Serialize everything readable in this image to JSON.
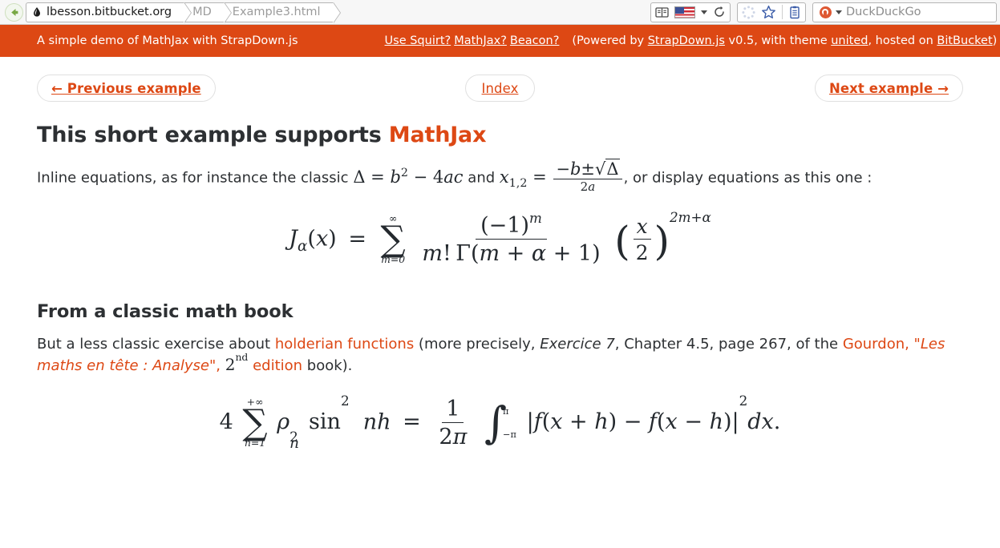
{
  "browser": {
    "back_icon": "back-arrow-icon",
    "breadcrumbs": [
      {
        "label": "lbesson.bitbucket.org",
        "kind": "host",
        "icon": "droplet-icon"
      },
      {
        "label": "MD",
        "kind": "dim"
      },
      {
        "label": "Example3.html",
        "kind": "dim"
      }
    ],
    "toolbar_icons": [
      "reader-mode-icon",
      "us-flag-icon",
      "language-caret-icon",
      "reload-icon",
      "loading-spinner-icon",
      "bookmark-star-icon",
      "clipboard-icon"
    ],
    "search": {
      "engine": "DuckDuckGo",
      "engine_icon": "duckduckgo-icon",
      "placeholder": "DuckDuckGo",
      "value": ""
    }
  },
  "navbar": {
    "brand": "A simple demo of MathJax with StrapDown.js",
    "links": [
      {
        "label": "Use Squirt?"
      },
      {
        "label": "MathJax?"
      },
      {
        "label": "Beacon?"
      }
    ],
    "powered_prefix": "(Powered by",
    "powered_link": "StrapDown.js",
    "version_text": "v0.5, with theme",
    "theme_link": "united",
    "hosted_text": ", hosted on",
    "host_link": "BitBucket",
    "close_paren": ")",
    "background": "#dd4814"
  },
  "nav_buttons": {
    "previous": "← Previous example",
    "index": "Index",
    "next": "Next example →",
    "text_color": "#dd4814"
  },
  "content": {
    "title_plain": "This short example supports ",
    "title_accent": "MathJax",
    "paragraph1": {
      "part1": "Inline equations, as for instance the classic ",
      "math1": "Δ = b² − 4ac",
      "part2": " and ",
      "math2": "x₁,₂ = (−b ± √Δ) / (2a)",
      "part3": ", or display equations as this one :"
    },
    "display_equation_1": "J_α(x) = Σ_{m=0}^{∞} (−1)^m / (m! Γ(m + α + 1)) · (x/2)^{2m+α}",
    "section_title": "From a classic math book",
    "paragraph2": {
      "part1": "But a less classic exercise about ",
      "link1": "holderian functions",
      "part2": " (more precisely, ",
      "italic1": "Exercice 7",
      "part3": ", Chapter 4.5, page 267, of the ",
      "link2_plain": "Gourdon, \"",
      "link2_italic": "Les maths en tête : Analyse",
      "link2_quote": "\"",
      "comma": ", ",
      "ordinal_base": "2",
      "ordinal_sup": "nd",
      "edition_word": " edition",
      "part4": " book)."
    },
    "display_equation_2": "4 Σ_{n=1}^{+∞} ρ_n² sin² nh = (1/2π) ∫_{−π}^{π} |f(x+h) − f(x−h)|² dx."
  }
}
